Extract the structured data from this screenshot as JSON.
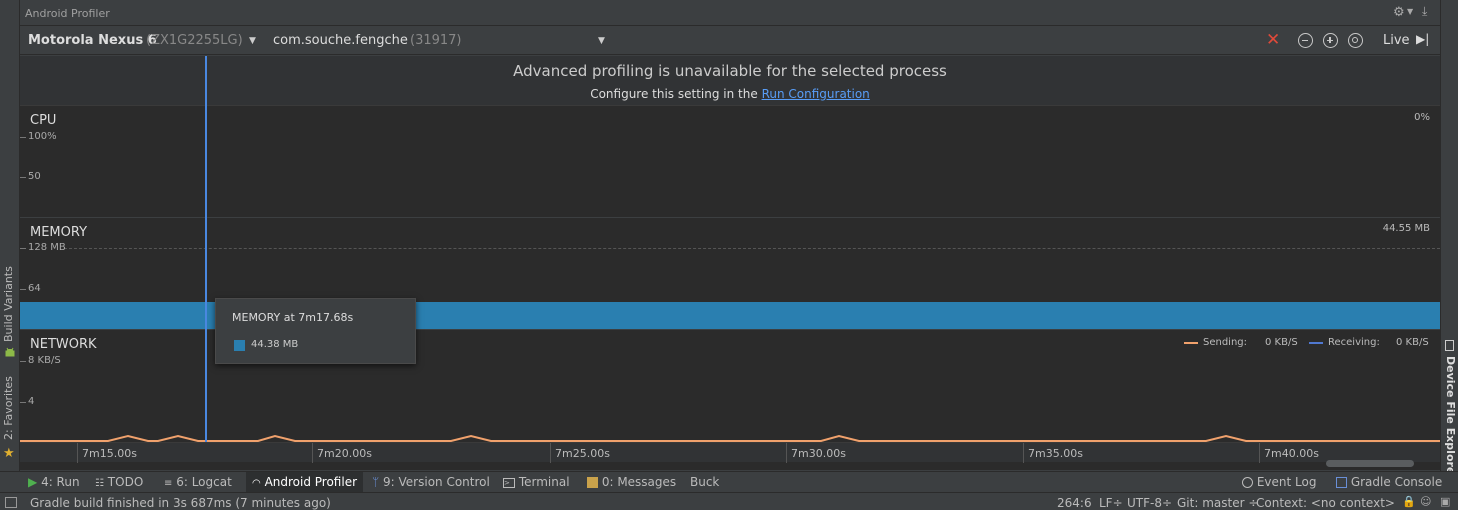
{
  "window": {
    "title": "Android Profiler"
  },
  "toolbar": {
    "device_name": "Motorola Nexus 6",
    "device_serial": "(ZX1G2255LG)",
    "process_name": "com.souche.fengche",
    "process_pid": "(31917)",
    "live_label": "Live"
  },
  "banner": {
    "title": "Advanced profiling is unavailable for the selected process",
    "subtitle_prefix": "Configure this setting in the",
    "link": "Run Configuration"
  },
  "cpu": {
    "title": "CPU",
    "value": "0%",
    "axis": [
      "100%",
      "50"
    ]
  },
  "memory": {
    "title": "MEMORY",
    "value": "44.55 MB",
    "axis": [
      "128 MB",
      "64"
    ],
    "tooltip_title": "MEMORY at 7m17.68s",
    "tooltip_value": "44.38 MB",
    "series_color": "#2a7fb0"
  },
  "network": {
    "title": "NETWORK",
    "axis": [
      "8 KB/S",
      "4"
    ],
    "sending_label": "Sending:",
    "sending_value": "0 KB/S",
    "receiving_label": "Receiving:",
    "receiving_value": "0 KB/S",
    "sending_color": "#f0a16c",
    "receiving_color": "#5078d0"
  },
  "timeline": {
    "ticks": [
      "7m15.00s",
      "7m20.00s",
      "7m25.00s",
      "7m30.00s",
      "7m35.00s",
      "7m40.00s"
    ]
  },
  "left_panel": {
    "build_variants": "Build Variants",
    "favorites": "2: Favorites"
  },
  "right_panel": {
    "device_file_explorer": "Device File Explorer"
  },
  "tool_windows": {
    "run": "4: Run",
    "todo": "TODO",
    "logcat": "6: Logcat",
    "android_profiler": "Android Profiler",
    "version_control": "9: Version Control",
    "terminal": "Terminal",
    "messages": "0: Messages",
    "buck": "Buck",
    "event_log": "Event Log",
    "gradle_console": "Gradle Console"
  },
  "status": {
    "message": "Gradle build finished in 3s 687ms (7 minutes ago)",
    "position": "264:6",
    "line_sep": "LF÷",
    "encoding": "UTF-8÷",
    "git": "Git: master ÷",
    "context": "Context: <no context>"
  }
}
